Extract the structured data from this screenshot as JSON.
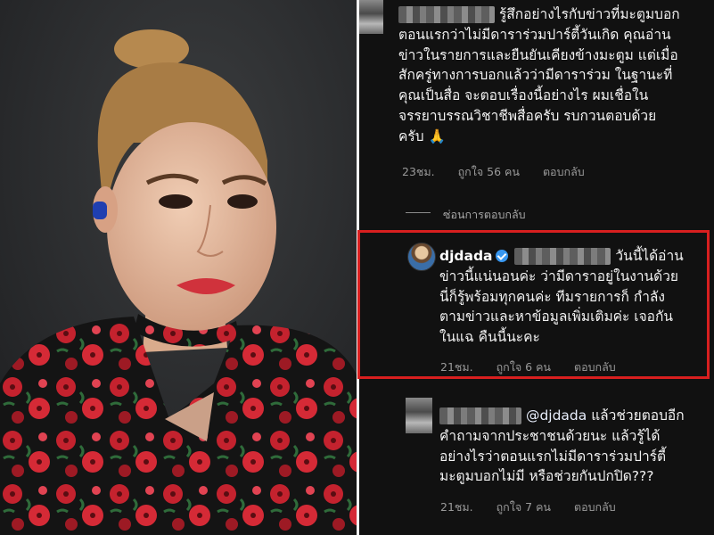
{
  "comment1": {
    "line1": "รู้สึกอย่างไรกับข่าวที่มะตูมบอก",
    "line2": "ตอนแรกว่าไม่มีดาราร่วมปาร์ตี้วันเกิด คุณอ่าน",
    "line3": "ข่าวในรายการและยืนยันเคียงข้างมะตูม แต่เมื่อ",
    "line4": "สักครู่ทางการบอกแล้วว่ามีดาราร่วม ในฐานะที่",
    "line5": "คุณเป็นสื่อ จะตอบเรื่องนี้อย่างไร ผมเชื่อใน",
    "line6": "จรรยาบรรณวิชาชีพสื่อครับ รบกวนตอบด้วย",
    "line7": "ครับ 🙏",
    "time": "23ชม.",
    "likes": "ถูกใจ 56 คน",
    "reply": "ตอบกลับ"
  },
  "hide_replies": "ซ่อนการตอบกลับ",
  "reply_dada": {
    "username": "djdada",
    "line1": "วันนี้ได้อ่าน",
    "line2": "ข่าวนี้แน่นอนค่ะ ว่ามีดาราอยู่ในงานด้วย",
    "line3": "นี่ก็รู้พร้อมทุกคนค่ะ ทีมรายการก็ กำลัง",
    "line4": "ตามข่าวและหาข้อมูลเพิ่มเติมค่ะ เจอกัน",
    "line5": "ในแฉ คืนนี้นะคะ",
    "time": "21ชม.",
    "likes": "ถูกใจ 6 คน",
    "reply": "ตอบกลับ"
  },
  "comment3": {
    "mention": "@djdada",
    "line1": " แล้วช่วยตอบอีก",
    "line2": "คำถามจากประชาชนด้วยนะ แล้วรู้ได้",
    "line3": "อย่างไรว่าตอนแรกไม่มีดาราร่วมปาร์ตี้",
    "line4": "มะตูมบอกไม่มี หรือช่วยกันปกปิด???",
    "time": "21ชม.",
    "likes": "ถูกใจ 7 คน",
    "reply": "ตอบกลับ"
  },
  "colors": {
    "highlight": "#d81f1f",
    "panel_bg": "#111111",
    "verified": "#3897f0"
  }
}
